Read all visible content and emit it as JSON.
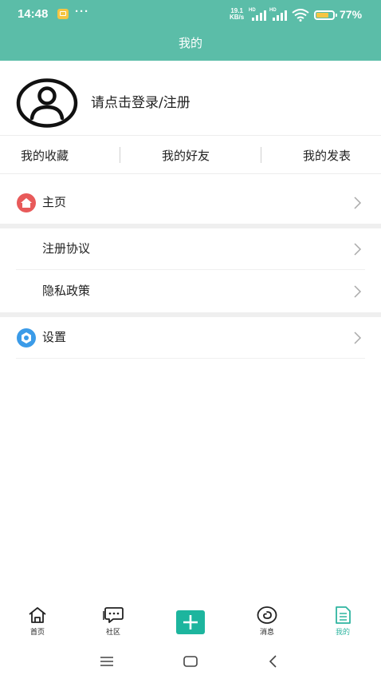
{
  "status_bar": {
    "time": "14:48",
    "dots": "···",
    "speed_value": "19.1",
    "speed_unit": "KB/s",
    "network_hd_1": "HD",
    "network_hd_2": "HD",
    "battery_percent": 77,
    "battery_text": "77%"
  },
  "header": {
    "title": "我的"
  },
  "profile": {
    "login_text": "请点击登录/注册"
  },
  "quick_links": [
    {
      "label": "我的收藏"
    },
    {
      "label": "我的好友"
    },
    {
      "label": "我的发表"
    }
  ],
  "menu": {
    "home": {
      "label": "主页",
      "icon": "home-icon"
    },
    "agreement": {
      "label": "注册协议"
    },
    "privacy": {
      "label": "隐私政策"
    },
    "settings": {
      "label": "设置",
      "icon": "gear-icon"
    }
  },
  "tabbar": {
    "tabs": [
      {
        "label": "首页",
        "icon": "house-outline-icon"
      },
      {
        "label": "社区",
        "icon": "chat-bubble-icon"
      },
      {
        "label": "",
        "icon": "plus-icon"
      },
      {
        "label": "消息",
        "icon": "spiral-message-icon"
      },
      {
        "label": "我的",
        "icon": "document-icon",
        "active": true
      }
    ]
  },
  "colors": {
    "header_bg": "#5bbda8",
    "accent": "#1db59e",
    "home_icon": "#e85a5a",
    "settings_icon": "#3b9be8"
  }
}
